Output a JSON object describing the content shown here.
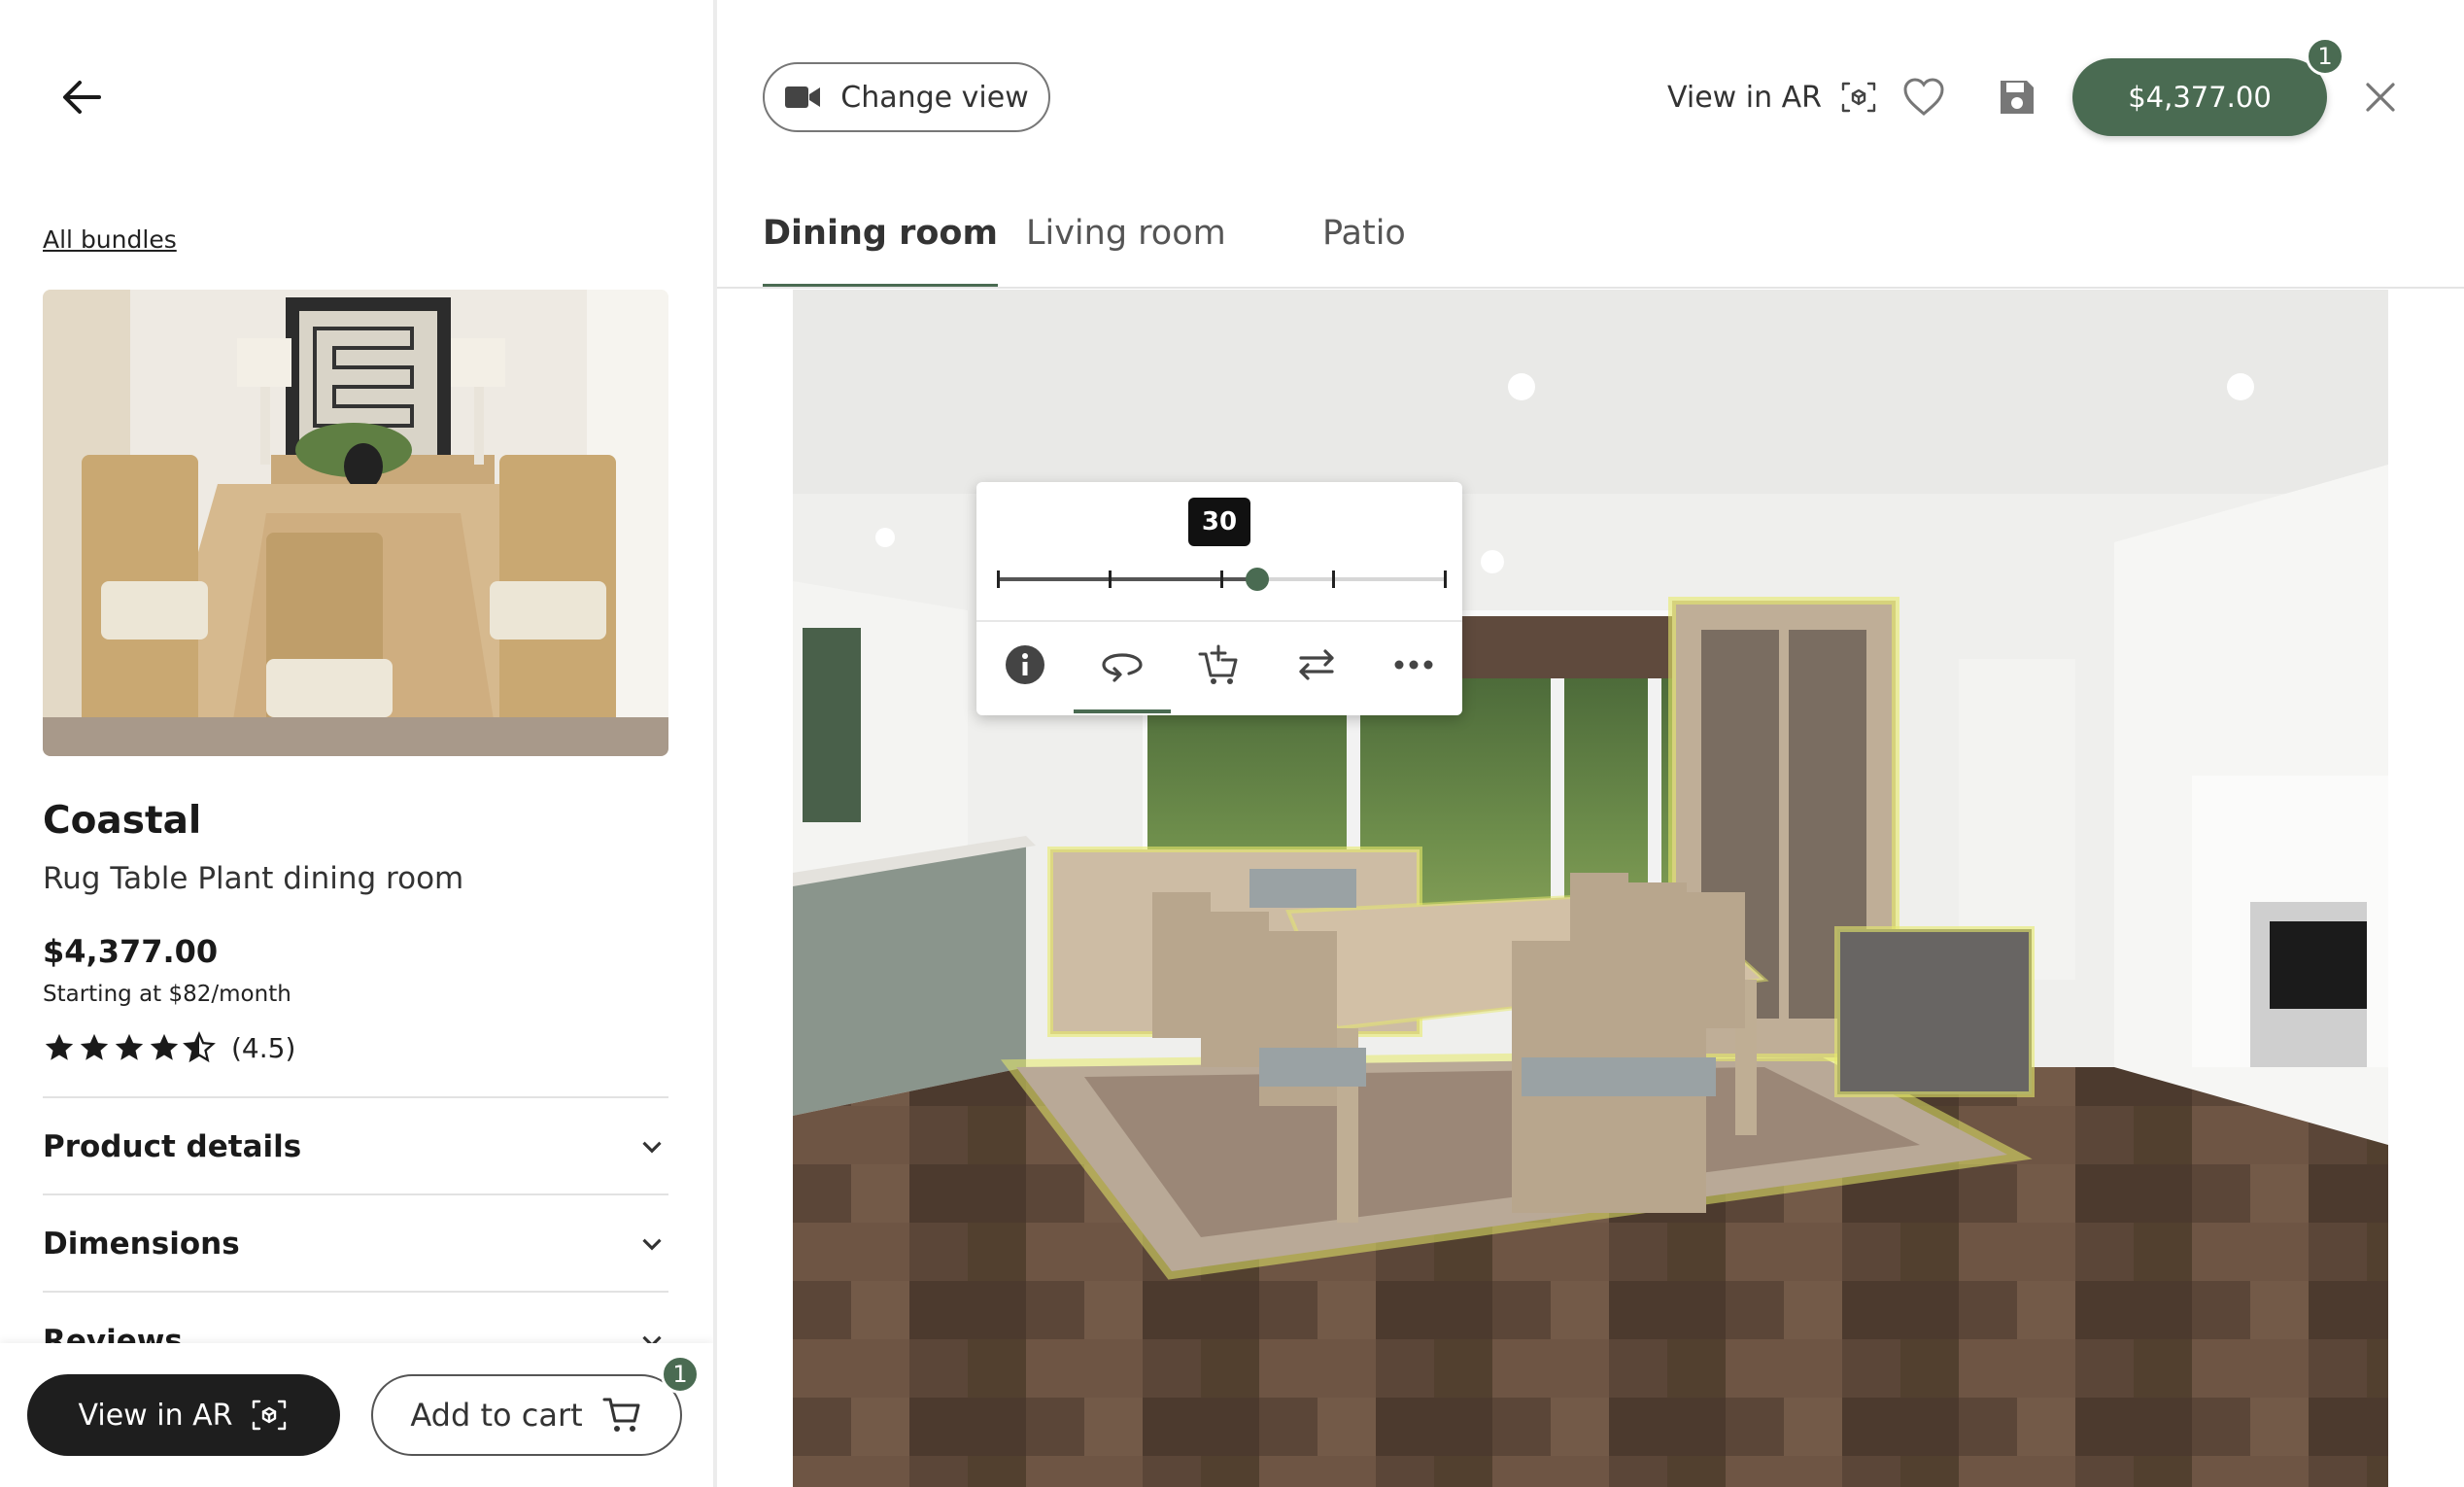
{
  "left_panel": {
    "all_bundles_link": "All bundles",
    "bundle": {
      "name": "Coastal",
      "subtitle": "Rug Table Plant dining room",
      "price": "$4,377.00",
      "monthly": "Starting at $82/month",
      "rating_value": 4.5,
      "rating_text": "(4.5)"
    },
    "accordion": [
      {
        "title": "Product details"
      },
      {
        "title": "Dimensions"
      },
      {
        "title": "Reviews"
      }
    ],
    "bottom_bar": {
      "view_ar_label": "View in AR",
      "add_to_cart_label": "Add to cart",
      "cart_badge": "1"
    }
  },
  "header": {
    "change_view_label": "Change view",
    "view_ar_label": "View in AR",
    "price_button": "$4,377.00",
    "price_badge": "1"
  },
  "tabs": [
    {
      "label": "Dining room",
      "active": true
    },
    {
      "label": "Living room",
      "active": false
    },
    {
      "label": "Patio",
      "active": false
    }
  ],
  "popup": {
    "slider_value": 30,
    "slider_value_label": "30",
    "slider_max": 40,
    "slider_ticks": 5,
    "icons": [
      "info-icon",
      "rotate-icon",
      "add-to-cart-icon",
      "swap-icon",
      "more-icon"
    ],
    "active_icon": "rotate-icon"
  },
  "colors": {
    "accent": "#4a6b52",
    "dark_button": "#1e1e1e",
    "selection_glow": "#e6ea6a"
  }
}
